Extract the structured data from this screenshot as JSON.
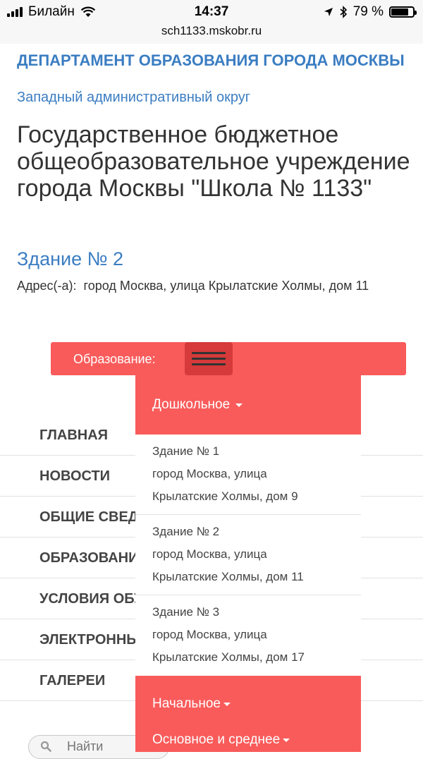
{
  "status_bar": {
    "carrier": "Билайн",
    "time": "14:37",
    "battery": "79 %",
    "battery_level": 0.79
  },
  "browser": {
    "url": "sch1133.mskobr.ru"
  },
  "header": {
    "department": "ДЕПАРТАМЕНТ ОБРАЗОВАНИЯ ГОРОДА МОСКВЫ",
    "district": "Западный административный округ",
    "school_name": "Государственное бюджетное общеобразовательное учреждение города Москвы \"Школа № 1133\"",
    "building": "Здание № 2",
    "address_label": "Адрес(-а):",
    "address": "город Москва, улица Крылатские Холмы, дом 11"
  },
  "edu_menu": {
    "label": "Образование:",
    "sections": [
      {
        "label": "Дошкольное"
      },
      {
        "label": "Начальное"
      },
      {
        "label": "Основное и среднее"
      }
    ],
    "preschool_buildings": [
      {
        "name": "Здание № 1",
        "address_line1": "город Москва, улица",
        "address_line2": "Крылатские Холмы, дом 9"
      },
      {
        "name": "Здание № 2",
        "address_line1": "город Москва, улица",
        "address_line2": "Крылатские Холмы, дом 11"
      },
      {
        "name": "Здание № 3",
        "address_line1": "город Москва, улица",
        "address_line2": "Крылатские Холмы, дом 17"
      }
    ]
  },
  "nav": {
    "items": [
      {
        "label": "ГЛАВНАЯ"
      },
      {
        "label": "НОВОСТИ"
      },
      {
        "label": "ОБЩИЕ СВЕДЕНИЯ"
      },
      {
        "label": "ОБРАЗОВАНИЕ"
      },
      {
        "label": "УСЛОВИЯ ОБУЧЕНИЯ"
      },
      {
        "label": "ЭЛЕКТРОННЫЕ СЕРВИСЫ"
      },
      {
        "label": "ГАЛЕРЕИ"
      }
    ]
  },
  "search": {
    "placeholder": "Найти"
  },
  "colors": {
    "accent": "#f95b5b",
    "link": "#3b7dc2",
    "hamburger": "#d63a3a"
  }
}
